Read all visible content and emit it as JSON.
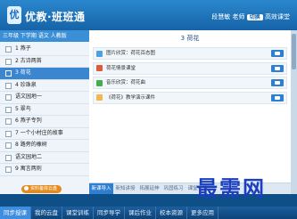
{
  "header": {
    "logo_char": "优",
    "brand": "优教·班班通",
    "user_label": "段慧敏",
    "teacher_label": "老师",
    "switch_label": "切换",
    "mode_label": "高效课堂"
  },
  "sidebar": {
    "course": "三年级 下学期 语文 人教版",
    "lessons": [
      {
        "label": "1 燕子"
      },
      {
        "label": "2 古诗两首"
      },
      {
        "label": "3 荷花"
      },
      {
        "label": "4 珍珠泉"
      },
      {
        "label": "语文园地一"
      },
      {
        "label": "5 翠鸟"
      },
      {
        "label": "6 燕子专列"
      },
      {
        "label": "7 一个小村庄的故事"
      },
      {
        "label": "8 路旁的橡树"
      },
      {
        "label": "语文园地二"
      },
      {
        "label": "9 寓言两则"
      }
    ],
    "cloud_button": "资料备库云盘"
  },
  "main": {
    "title": "3 荷花",
    "resources": [
      {
        "label": "图片欣赏：荷花百态图",
        "icon_color": "#4aa3e0"
      },
      {
        "label": "荷花情景课堂",
        "icon_color": "#e05a3a"
      },
      {
        "label": "音乐欣赏：荷花曲",
        "icon_color": "#3fb04a"
      },
      {
        "label": "《荷花》教学演示课件",
        "icon_color": "#f2b84b"
      }
    ],
    "tabs": [
      "新课导入",
      "新知讲授",
      "拓展延伸",
      "巩固练习",
      "课堂小结"
    ]
  },
  "watermark": "最需网",
  "bottom_nav": [
    "同步授课",
    "我的云盘",
    "课堂训练",
    "同步导学",
    "课后作业",
    "校本资源",
    "更多应用"
  ]
}
